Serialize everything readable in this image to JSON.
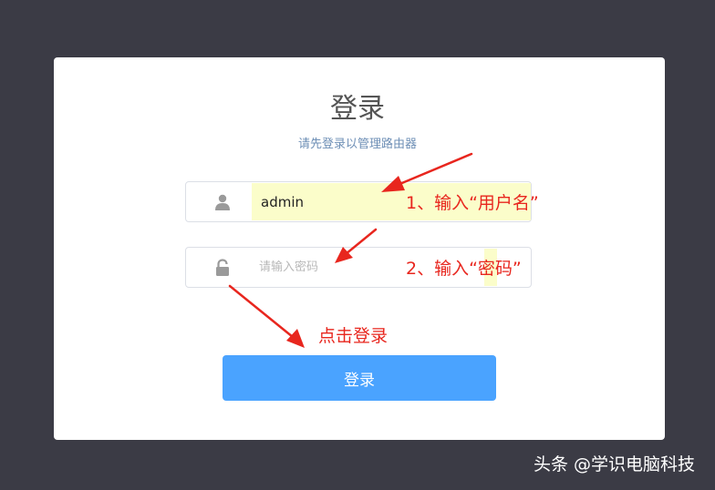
{
  "login": {
    "title": "登录",
    "subtitle": "请先登录以管理路由器",
    "username_value": "admin",
    "password_placeholder": "请输入密码",
    "button_label": "登录"
  },
  "annotations": {
    "step1": "1、输入“用户名”",
    "step2": "2、输入“密码”",
    "step3": "点击登录"
  },
  "watermark": "头条 @学识电脑科技",
  "colors": {
    "background": "#3b3b45",
    "primary_button": "#4aa3ff",
    "annotation": "#e8261e",
    "autofill": "#fbfdca"
  },
  "icons": {
    "username": "user-icon",
    "password": "lock-icon"
  }
}
